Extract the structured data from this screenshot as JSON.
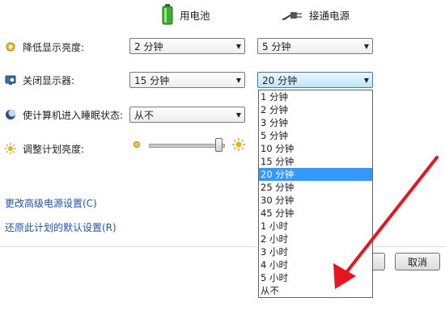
{
  "columns": {
    "battery": {
      "label": "用电池",
      "icon": "battery-icon"
    },
    "plugged": {
      "label": "接通电源",
      "icon": "power-plug-icon"
    }
  },
  "rows": [
    {
      "label": "降低显示亮度:",
      "icon": "dim-display-icon",
      "battery_value": "2 分钟",
      "plugged_value": "5 分钟"
    },
    {
      "label": "关闭显示器:",
      "icon": "monitor-off-icon",
      "battery_value": "15 分钟",
      "plugged_value": "20 分钟"
    },
    {
      "label": "使计算机进入睡眠状态:",
      "icon": "sleep-moon-icon",
      "battery_value": "从不"
    },
    {
      "label": "调整计划亮度:",
      "icon": "brightness-sun-icon"
    }
  ],
  "brightness": {
    "level": 0.92
  },
  "dropdown": {
    "options": [
      "1 分钟",
      "2 分钟",
      "3 分钟",
      "5 分钟",
      "10 分钟",
      "15 分钟",
      "20 分钟",
      "25 分钟",
      "30 分钟",
      "45 分钟",
      "1 小时",
      "2 小时",
      "3 小时",
      "4 小时",
      "5 小时",
      "从不"
    ],
    "selected_index": 6
  },
  "links": {
    "advanced": "更改高级电源设置(C)",
    "restore": "还原此计划的默认设置(R)"
  },
  "buttons": {
    "cancel": "取消"
  },
  "colors": {
    "arrow": "#e8141e",
    "selection": "#3399ff",
    "link": "#1a55b4"
  }
}
